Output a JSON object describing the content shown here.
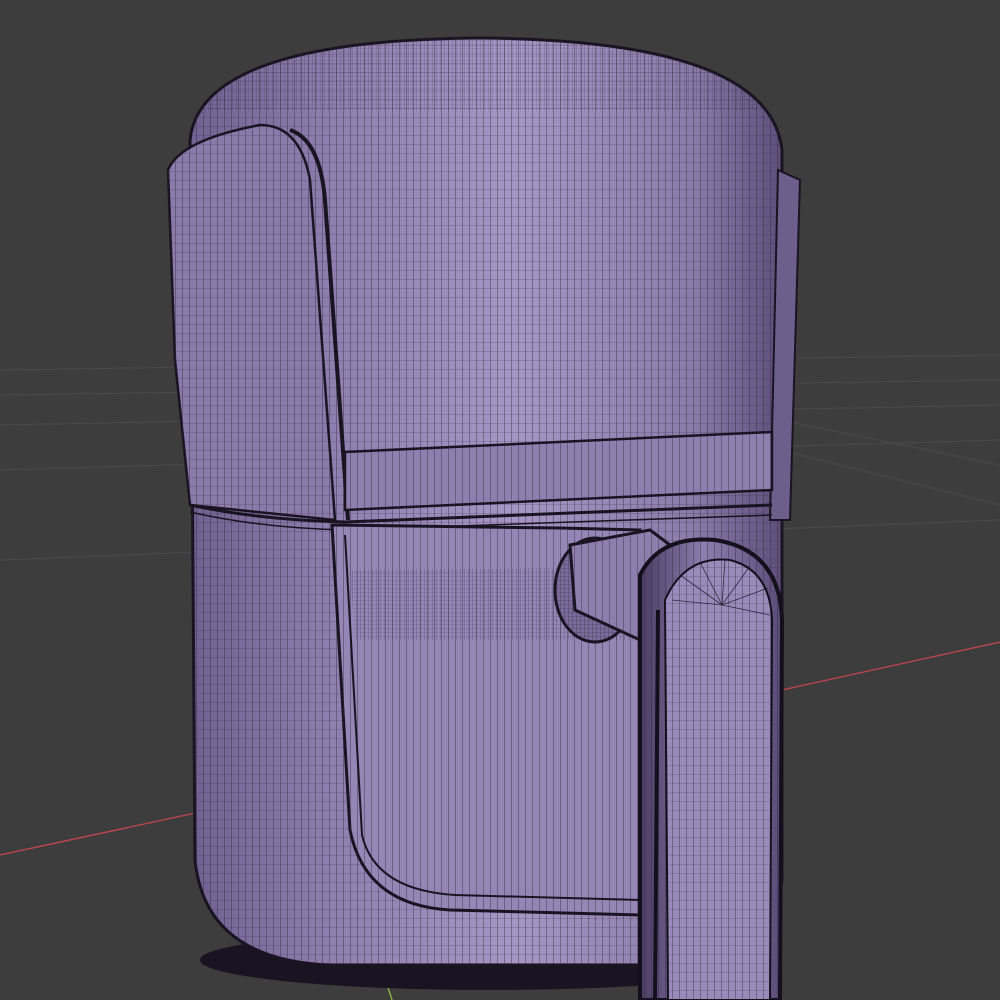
{
  "viewport": {
    "background": "#3d3d3d",
    "grid_color": "#4a4a4a",
    "x_axis_color": "#c0454f",
    "y_axis_color": "#8db53c"
  },
  "model": {
    "object": "air-fryer-icon",
    "display_mode": "wireframe",
    "body_color": "#9a8ab8",
    "body_dark": "#6a5a8a",
    "wire_color": "#2a2138"
  }
}
